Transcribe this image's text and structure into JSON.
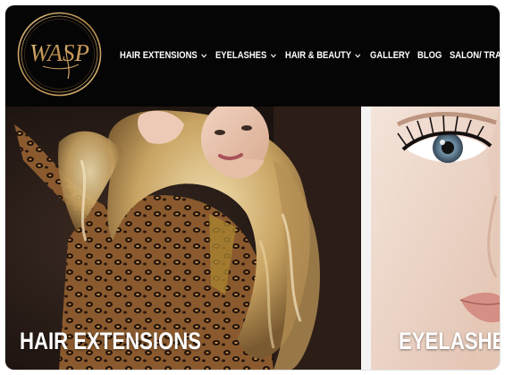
{
  "brand": {
    "logo_text": "WASP",
    "logo_color": "#c9a46b"
  },
  "nav": {
    "items": [
      {
        "label": "HAIR EXTENSIONS",
        "dropdown": true
      },
      {
        "label": "EYELASHES",
        "dropdown": true
      },
      {
        "label": "HAIR & BEAUTY",
        "dropdown": true
      },
      {
        "label": "GALLERY",
        "dropdown": false
      },
      {
        "label": "BLOG",
        "dropdown": false
      },
      {
        "label": "SALON/ TRA",
        "dropdown": false
      }
    ]
  },
  "panels": {
    "hair_extensions": {
      "label": "HAIR EXTENSIONS"
    },
    "eyelashes": {
      "label": "EYELASHES"
    }
  },
  "colors": {
    "header_bg": "#050505",
    "nav_text": "#ffffff",
    "hair_gold": "#d8bf8a",
    "leopard_base": "#8a5a2e"
  }
}
